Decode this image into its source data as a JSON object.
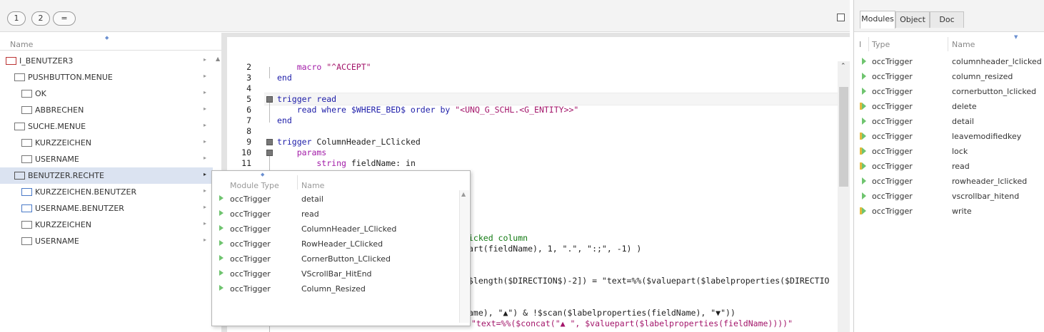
{
  "toolbar": {
    "buttons": [
      "1",
      "2",
      "="
    ]
  },
  "tree": {
    "header": "Name",
    "items": [
      {
        "label": "I_BENUTZER3",
        "icon": "entity-icon",
        "selected": false
      },
      {
        "label": "PUSHBUTTON.MENUE",
        "icon": "panel-icon",
        "selected": false
      },
      {
        "label": "OK",
        "icon": "button-icon",
        "selected": false
      },
      {
        "label": "ABBRECHEN",
        "icon": "button-icon",
        "selected": false
      },
      {
        "label": "SUCHE.MENUE",
        "icon": "panel-icon",
        "selected": false
      },
      {
        "label": "KURZZEICHEN",
        "icon": "editbox-icon",
        "selected": false
      },
      {
        "label": "USERNAME",
        "icon": "editbox-icon",
        "selected": false
      },
      {
        "label": "BENUTZER.RECHTE",
        "icon": "grid-icon",
        "selected": true
      },
      {
        "label": "KURZZEICHEN.BENUTZER",
        "icon": "label-icon",
        "selected": false
      },
      {
        "label": "USERNAME.BENUTZER",
        "icon": "label-icon",
        "selected": false
      },
      {
        "label": "KURZZEICHEN",
        "icon": "field-icon",
        "selected": false
      },
      {
        "label": "USERNAME",
        "icon": "field-icon",
        "selected": false
      }
    ]
  },
  "editor": {
    "line_numbers": [
      "2",
      "3",
      "4",
      "5",
      "6",
      "7",
      "8",
      "9",
      "10",
      "11"
    ],
    "code": {
      "l2_a": "    macro ",
      "l2_b": "\"^ACCEPT\"",
      "l3": "end",
      "l5_kw": "trigger ",
      "l5_name": "read",
      "l6_a": "    read where $WHERE_BED$ order by ",
      "l6_b": "\"<UNQ_G_SCHL.<G_ENTITY>>\"",
      "l7": "end",
      "l9_kw": "trigger ",
      "l9_name": "ColumnHeader_LClicked",
      "l10": "    params",
      "l11_kw": "        string ",
      "l11_rest": "fieldName: in",
      "frag1": "icked column",
      "frag2": "art(fieldName), 1, \".\", \":;\", -1) )",
      "frag3": "$length($DIRECTION$)-2]) = \"text=%%($valuepart($labelproperties($DIRECTIO",
      "frag4": "ame), \"▲\") & !$scan($labelproperties(fieldName), \"▼\"))",
      "frag5": "\"text=%%($concat(\"▲ \", $valuepart($labelproperties(fieldName))))\""
    }
  },
  "popup": {
    "col_type": "Module Type",
    "col_name": "Name",
    "rows": [
      {
        "type": "occTrigger",
        "name": "detail"
      },
      {
        "type": "occTrigger",
        "name": "read"
      },
      {
        "type": "occTrigger",
        "name": "ColumnHeader_LClicked"
      },
      {
        "type": "occTrigger",
        "name": "RowHeader_LClicked"
      },
      {
        "type": "occTrigger",
        "name": "CornerButton_LClicked"
      },
      {
        "type": "occTrigger",
        "name": "VScrollBar_HitEnd"
      },
      {
        "type": "occTrigger",
        "name": "Column_Resized"
      }
    ]
  },
  "right": {
    "tabs": [
      "Modules",
      "Object",
      "Doc"
    ],
    "col_i": "I",
    "col_type": "Type",
    "col_name": "Name",
    "rows": [
      {
        "type": "occTrigger",
        "name": "columnheader_lclicked",
        "marker": false
      },
      {
        "type": "occTrigger",
        "name": "column_resized",
        "marker": false
      },
      {
        "type": "occTrigger",
        "name": "cornerbutton_lclicked",
        "marker": false
      },
      {
        "type": "occTrigger",
        "name": "delete",
        "marker": true
      },
      {
        "type": "occTrigger",
        "name": "detail",
        "marker": false
      },
      {
        "type": "occTrigger",
        "name": "leavemodifiedkey",
        "marker": true
      },
      {
        "type": "occTrigger",
        "name": "lock",
        "marker": true
      },
      {
        "type": "occTrigger",
        "name": "read",
        "marker": true
      },
      {
        "type": "occTrigger",
        "name": "rowheader_lclicked",
        "marker": false
      },
      {
        "type": "occTrigger",
        "name": "vscrollbar_hitend",
        "marker": false
      },
      {
        "type": "occTrigger",
        "name": "write",
        "marker": true
      }
    ]
  }
}
